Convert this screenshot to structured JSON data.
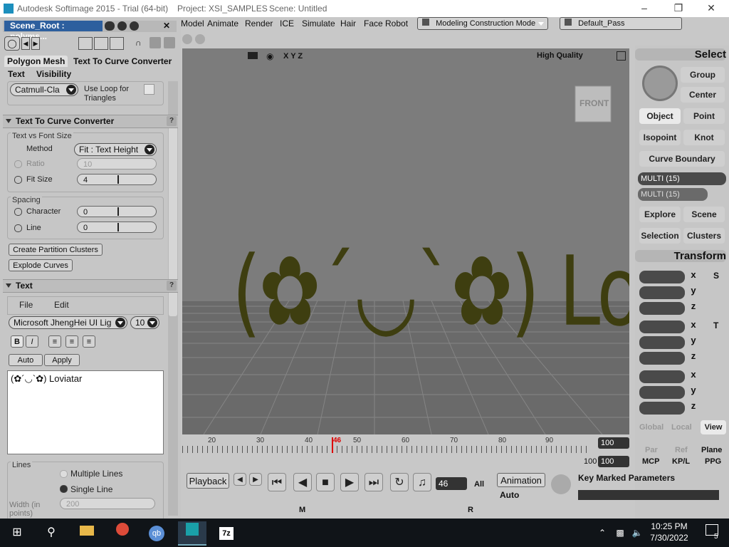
{
  "titlebar": {
    "app": "Autodesk Softimage 2015 - Trial (64-bit)",
    "project": "Project: XSI_SAMPLES",
    "scene": "Scene: Untitled"
  },
  "left": {
    "header_title": "Scene_Root : polyms...",
    "tabs": [
      "Polygon Mesh",
      "Text To Curve Converter",
      "Text",
      "Visibility"
    ],
    "subdiv_select": "Catmull-Cla",
    "use_loop_label": "Use Loop for Triangles",
    "converter": {
      "title": "Text To Curve Converter",
      "text_vs_font": "Text vs Font Size",
      "method_label": "Method",
      "method_value": "Fit : Text Height",
      "ratio_label": "Ratio",
      "ratio_value": "10",
      "fitsize_label": "Fit Size",
      "fitsize_value": "4",
      "spacing_label": "Spacing",
      "character_label": "Character",
      "character_value": "0",
      "line_label": "Line",
      "line_value": "0",
      "create_partition": "Create Partition Clusters",
      "explode_curves": "Explode Curves"
    },
    "text": {
      "title": "Text",
      "file": "File",
      "edit": "Edit",
      "font": "Microsoft JhengHei UI Lig",
      "size": "10",
      "bold": "B",
      "italic": "I",
      "auto": "Auto",
      "apply": "Apply",
      "content": "(✿´◡`✿) Loviatar",
      "lines_label": "Lines",
      "multiple_lines": "Multiple Lines",
      "single_line": "Single Line",
      "width_label": "Width (in points)",
      "width_value": "200"
    }
  },
  "menu": {
    "items": [
      "Model",
      "Animate",
      "Render",
      "ICE",
      "Simulate",
      "Hair",
      "Face Robot"
    ],
    "mode": "Modeling Construction Mode",
    "pass": "Default_Pass"
  },
  "viewport": {
    "axes": "X Y Z",
    "quality": "High Quality",
    "front_label": "FRONT",
    "scene_text": "(✿´◡`✿) Loviatar"
  },
  "right": {
    "select_title": "Select",
    "group": "Group",
    "center": "Center",
    "object": "Object",
    "point": "Point",
    "isopoint": "Isopoint",
    "knot": "Knot",
    "curve_boundary": "Curve Boundary",
    "multi1": "MULTI (15)",
    "multi2": "MULTI (15)",
    "explore": "Explore",
    "scene": "Scene",
    "selection": "Selection",
    "clusters": "Clusters",
    "transform_title": "Transform",
    "axes": [
      "x",
      "y",
      "z",
      "x",
      "y",
      "z",
      "x",
      "y",
      "z"
    ],
    "s_icon": "S",
    "r_icon": "R",
    "t_icon": "T",
    "global": "Global",
    "local": "Local",
    "view": "View",
    "par": "Par",
    "ref": "Ref",
    "plane": "Plane",
    "mcp": "MCP",
    "kpl": "KP/L",
    "ppg": "PPG"
  },
  "timeline": {
    "ticks": [
      "20",
      "30",
      "40",
      "50",
      "60",
      "70",
      "80",
      "90"
    ],
    "current": "46",
    "end1": "100",
    "end2": "100",
    "start_end": "100"
  },
  "playback": {
    "playback": "Playback",
    "frame": "46",
    "all": "All",
    "animation": "Animation",
    "auto": "Auto",
    "key_marked": "Key Marked Parameters",
    "m": "M",
    "r": "R"
  },
  "taskbar": {
    "time": "10:25 PM",
    "date": "7/30/2022",
    "notif": "5"
  }
}
